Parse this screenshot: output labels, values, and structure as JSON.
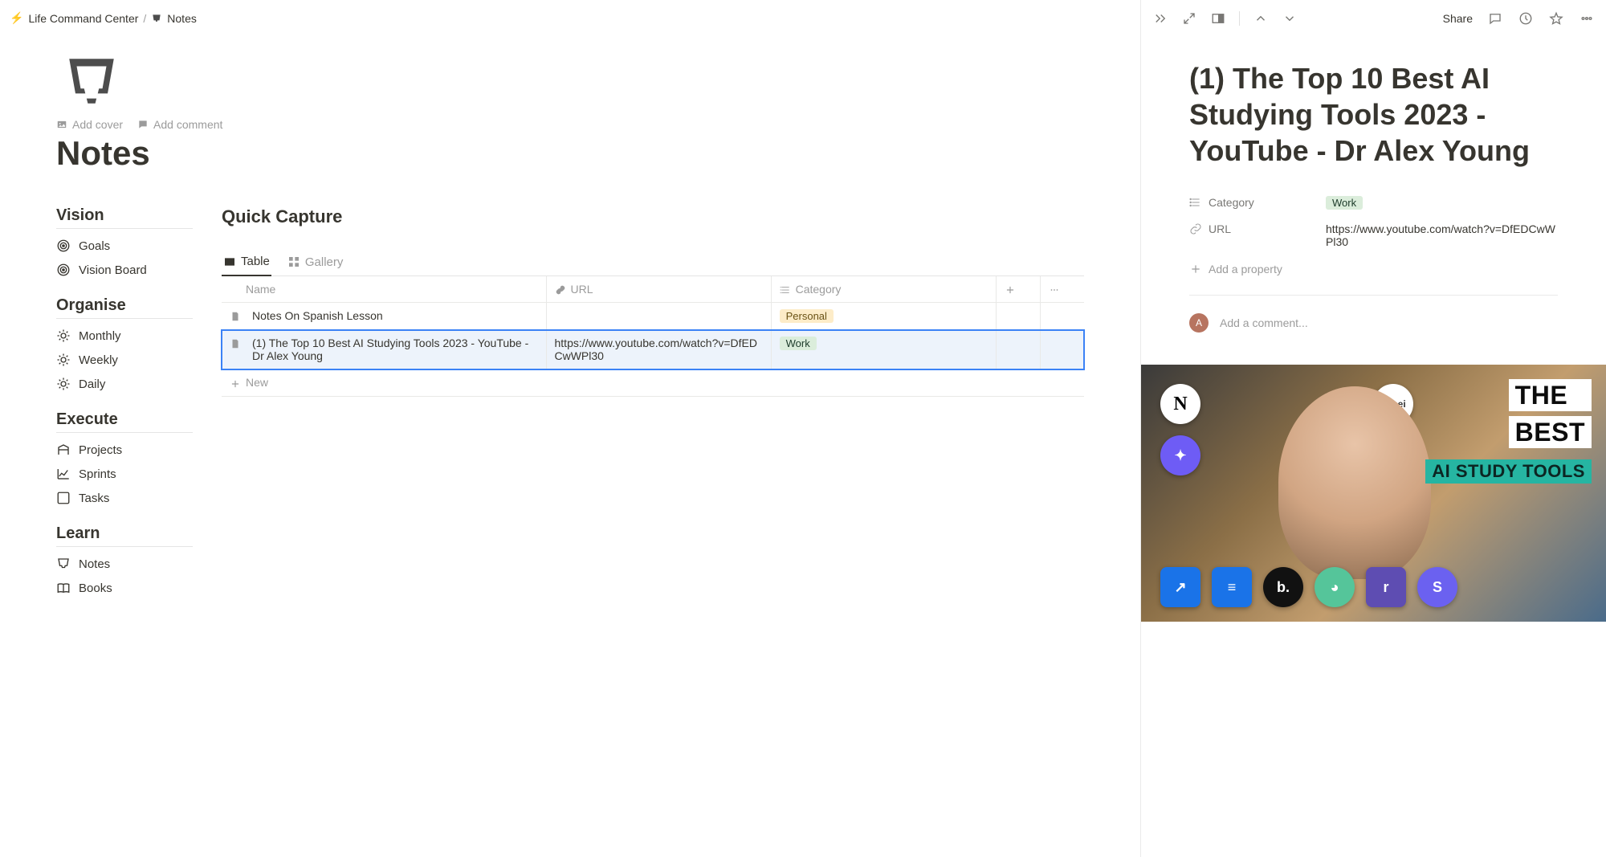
{
  "breadcrumb": {
    "parent": "Life Command Center",
    "separator": "/",
    "current": "Notes"
  },
  "cover_btn": "Add cover",
  "comment_btn": "Add comment",
  "page_title": "Notes",
  "nav": {
    "vision": {
      "title": "Vision",
      "items": [
        "Goals",
        "Vision Board"
      ]
    },
    "organise": {
      "title": "Organise",
      "items": [
        "Monthly",
        "Weekly",
        "Daily"
      ]
    },
    "execute": {
      "title": "Execute",
      "items": [
        "Projects",
        "Sprints",
        "Tasks"
      ]
    },
    "learn": {
      "title": "Learn",
      "items": [
        "Notes",
        "Books"
      ]
    }
  },
  "section_title": "Quick Capture",
  "tabs": {
    "table": "Table",
    "gallery": "Gallery"
  },
  "columns": {
    "name": "Name",
    "url": "URL",
    "category": "Category"
  },
  "rows": [
    {
      "name": "Notes On Spanish Lesson",
      "url": "",
      "category": "Personal",
      "cat_class": "personal"
    },
    {
      "name": "(1) The Top 10 Best AI Studying Tools 2023 - YouTube - Dr Alex Young",
      "url": "https://www.youtube.com/watch?v=DfEDCwWPl30",
      "category": "Work",
      "cat_class": "work"
    }
  ],
  "new_row": "New",
  "detail": {
    "share": "Share",
    "title": "(1) The Top 10 Best AI Studying Tools 2023 - YouTube - Dr Alex Young",
    "props": {
      "category_label": "Category",
      "category_value": "Work",
      "url_label": "URL",
      "url_value": "https://www.youtube.com/watch?v=DfEDCwWPl30"
    },
    "add_property": "Add a property",
    "avatar_initial": "A",
    "comment_placeholder": "Add a comment...",
    "thumb": {
      "line1": "THE",
      "line2": "BEST",
      "banner": "AI STUDY TOOLS"
    }
  }
}
